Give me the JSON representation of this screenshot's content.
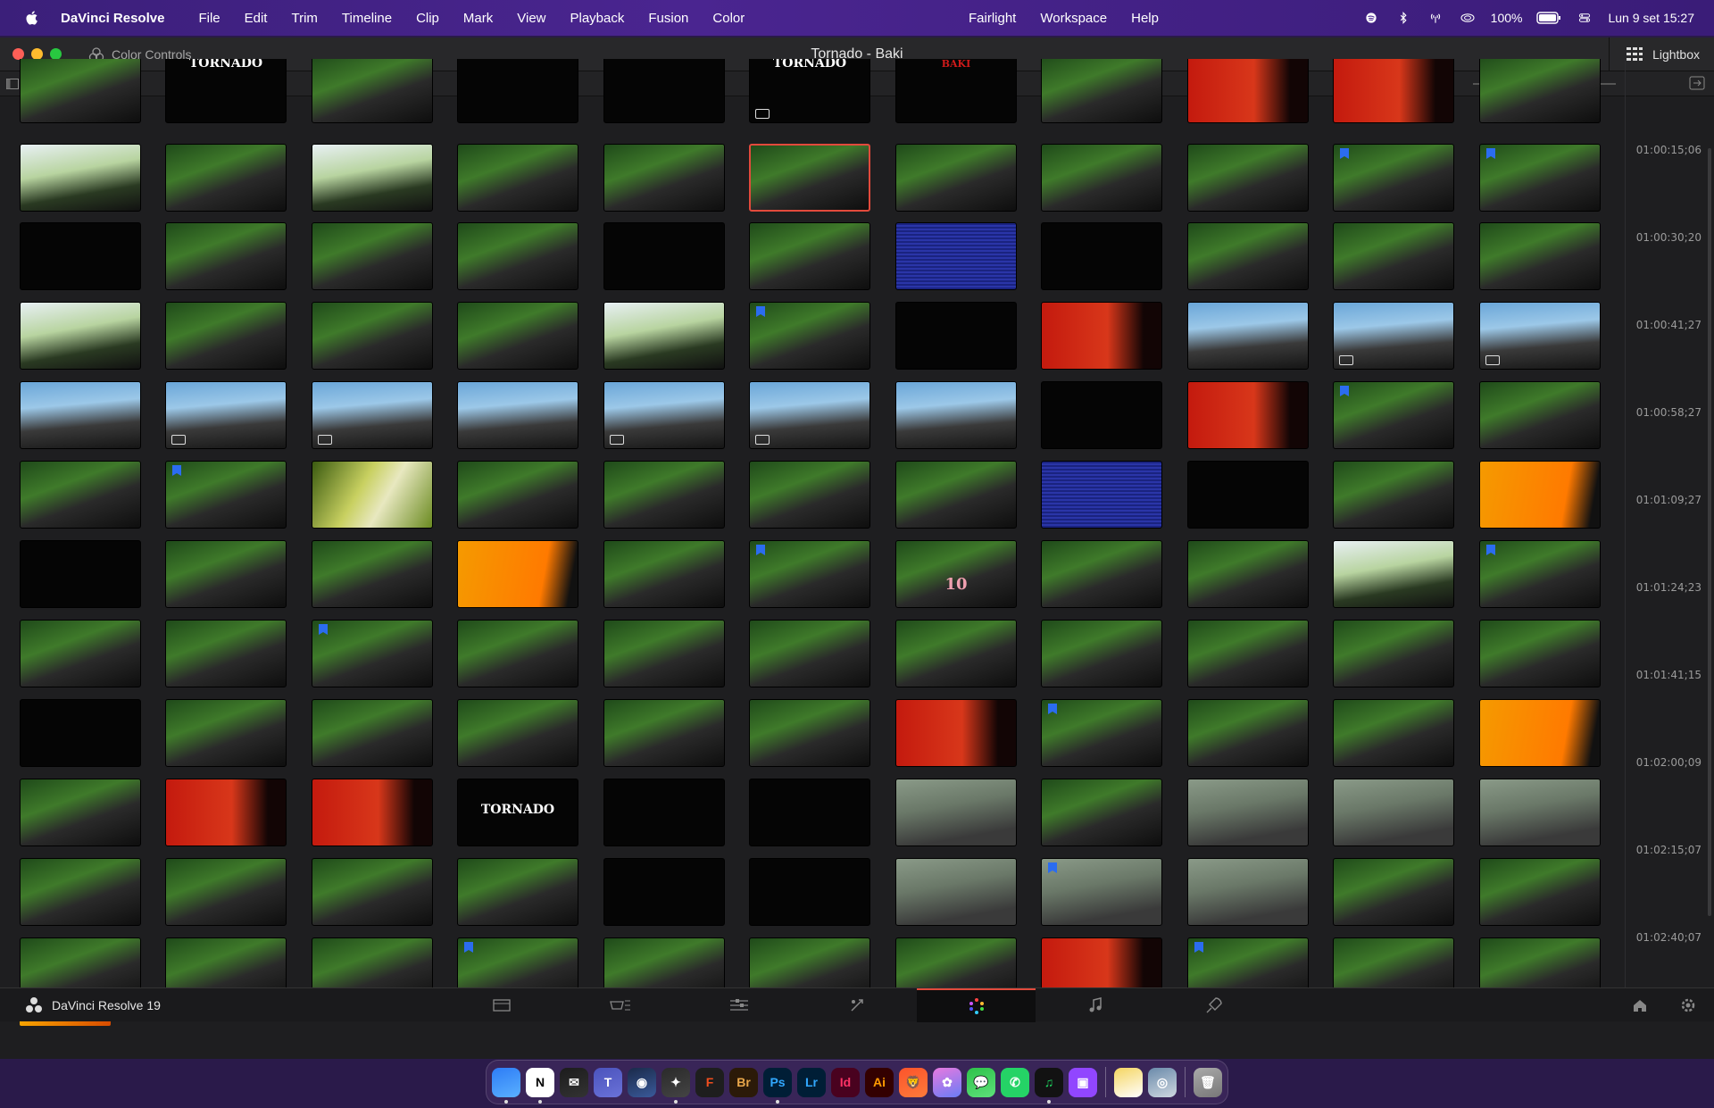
{
  "menubar": {
    "app_name": "DaVinci Resolve",
    "menus": [
      "File",
      "Edit",
      "Trim",
      "Timeline",
      "Clip",
      "Mark",
      "View",
      "Playback",
      "Fusion",
      "Color"
    ],
    "menus_right": [
      "Fairlight",
      "Workspace",
      "Help"
    ],
    "battery": "100%",
    "clock": "Lun 9 set  15:27"
  },
  "window": {
    "panel_label": "Color Controls",
    "title": "Tornado - Baki",
    "lightbox_label": "Lightbox"
  },
  "timecodes": [
    "01:00:15;06",
    "01:00:30;20",
    "01:00:41;27",
    "01:00:58;27",
    "01:01:09;27",
    "01:01:24;23",
    "01:01:41;15",
    "01:02:00;09",
    "01:02:15;07",
    "01:02:40;07"
  ],
  "thumb_text": {
    "tornado_top": "TORNADO",
    "baki_top": "BAKI",
    "tornado_mid": "TORNADO",
    "jersey_number": "10"
  },
  "thumbnails": [
    [
      "g",
      "k",
      "g",
      "k",
      "k",
      "k",
      "k",
      "g",
      "r",
      "r",
      "g"
    ],
    [
      "w",
      "g",
      "w",
      "g",
      "g",
      "g",
      "g",
      "g",
      "g",
      "g",
      "g"
    ],
    [
      "k",
      "g",
      "g",
      "g",
      "k",
      "g",
      "b",
      "k",
      "g",
      "g",
      "g"
    ],
    [
      "w",
      "g",
      "g",
      "g",
      "w",
      "g",
      "k",
      "r",
      "s",
      "s",
      "s"
    ],
    [
      "s",
      "s",
      "s",
      "s",
      "s",
      "s",
      "s",
      "k",
      "r",
      "g",
      "g"
    ],
    [
      "g",
      "g",
      "y",
      "g",
      "g",
      "g",
      "g",
      "b",
      "k",
      "g",
      "o"
    ],
    [
      "k",
      "g",
      "g",
      "o",
      "g",
      "g",
      "g",
      "g",
      "g",
      "w",
      "g"
    ],
    [
      "g",
      "g",
      "g",
      "g",
      "g",
      "g",
      "g",
      "g",
      "g",
      "g",
      "g"
    ],
    [
      "k",
      "g",
      "g",
      "g",
      "g",
      "g",
      "r",
      "g",
      "g",
      "g",
      "o"
    ],
    [
      "g",
      "r",
      "r",
      "k",
      "k",
      "k",
      "f",
      "g",
      "f",
      "f",
      "f"
    ],
    [
      "g",
      "g",
      "g",
      "g",
      "k",
      "k",
      "f",
      "f",
      "f",
      "g",
      "g"
    ],
    [
      "g",
      "g",
      "g",
      "g",
      "g",
      "g",
      "g",
      "r",
      "g",
      "g",
      "g"
    ]
  ],
  "page_bar": {
    "brand": "DaVinci Resolve 19",
    "active_page": "color"
  },
  "dock": {
    "apps": [
      "Finder",
      "Notion",
      "Mail",
      "Teams",
      "Cinema 4D",
      "DaVinci Resolve",
      "Figma",
      "Br",
      "Ps",
      "Lr",
      "Id",
      "Ai",
      "Brave",
      "App",
      "Messages",
      "WhatsApp",
      "Spotify",
      "Twitch",
      "Notes",
      "Preview",
      "Trash"
    ]
  }
}
